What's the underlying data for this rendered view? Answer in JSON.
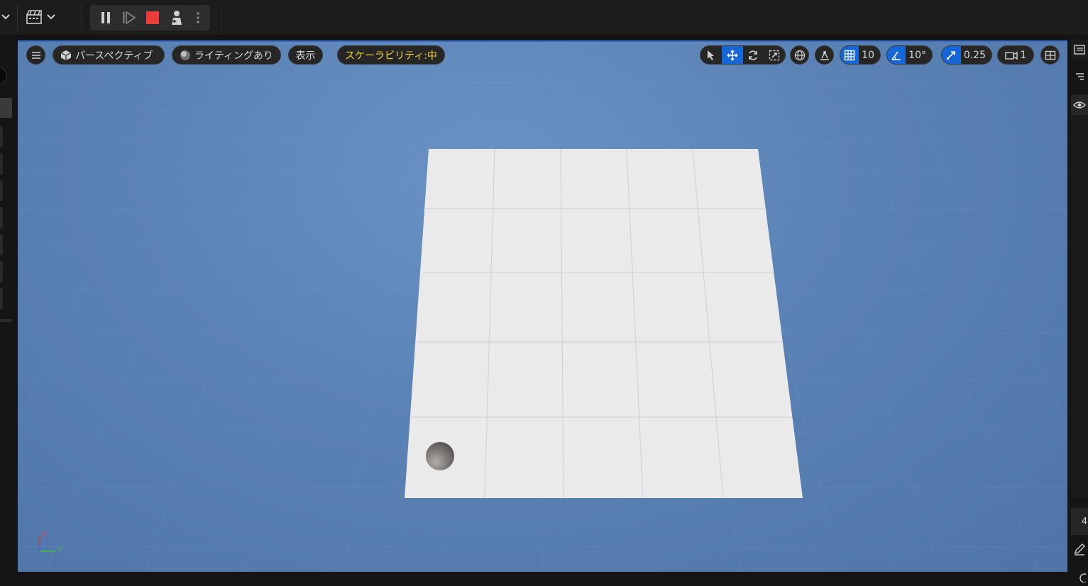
{
  "viewport_toolbar": {
    "perspective_label": "パースペクティブ",
    "lighting_label": "ライティングあり",
    "show_label": "表示",
    "scalability_label": "スケーラビリティ:中",
    "grid_snap_value": "10",
    "rotation_snap_value": "10°",
    "scale_snap_value": "0.25",
    "camera_speed_value": "1"
  },
  "axis": {
    "x": "X",
    "y": "Y",
    "z": "Z"
  },
  "right_panel": {
    "partial_number": "4"
  },
  "icons": [
    "hamburger-icon",
    "cube-icon",
    "sphere-icon",
    "select-icon",
    "translate-icon",
    "rotate-icon",
    "scale-icon",
    "globe-icon",
    "surface-snap-icon",
    "grid-icon",
    "angle-icon",
    "scale-snap-icon",
    "camera-icon",
    "layout-icon",
    "pause-icon",
    "step-icon",
    "stop-icon",
    "possess-icon",
    "more-icon",
    "cinematics-icon"
  ],
  "colors": {
    "accent": "#1566d6",
    "scalability": "#f2d23c",
    "stop": "#ee3b3b",
    "sky": "#5b82b5"
  }
}
